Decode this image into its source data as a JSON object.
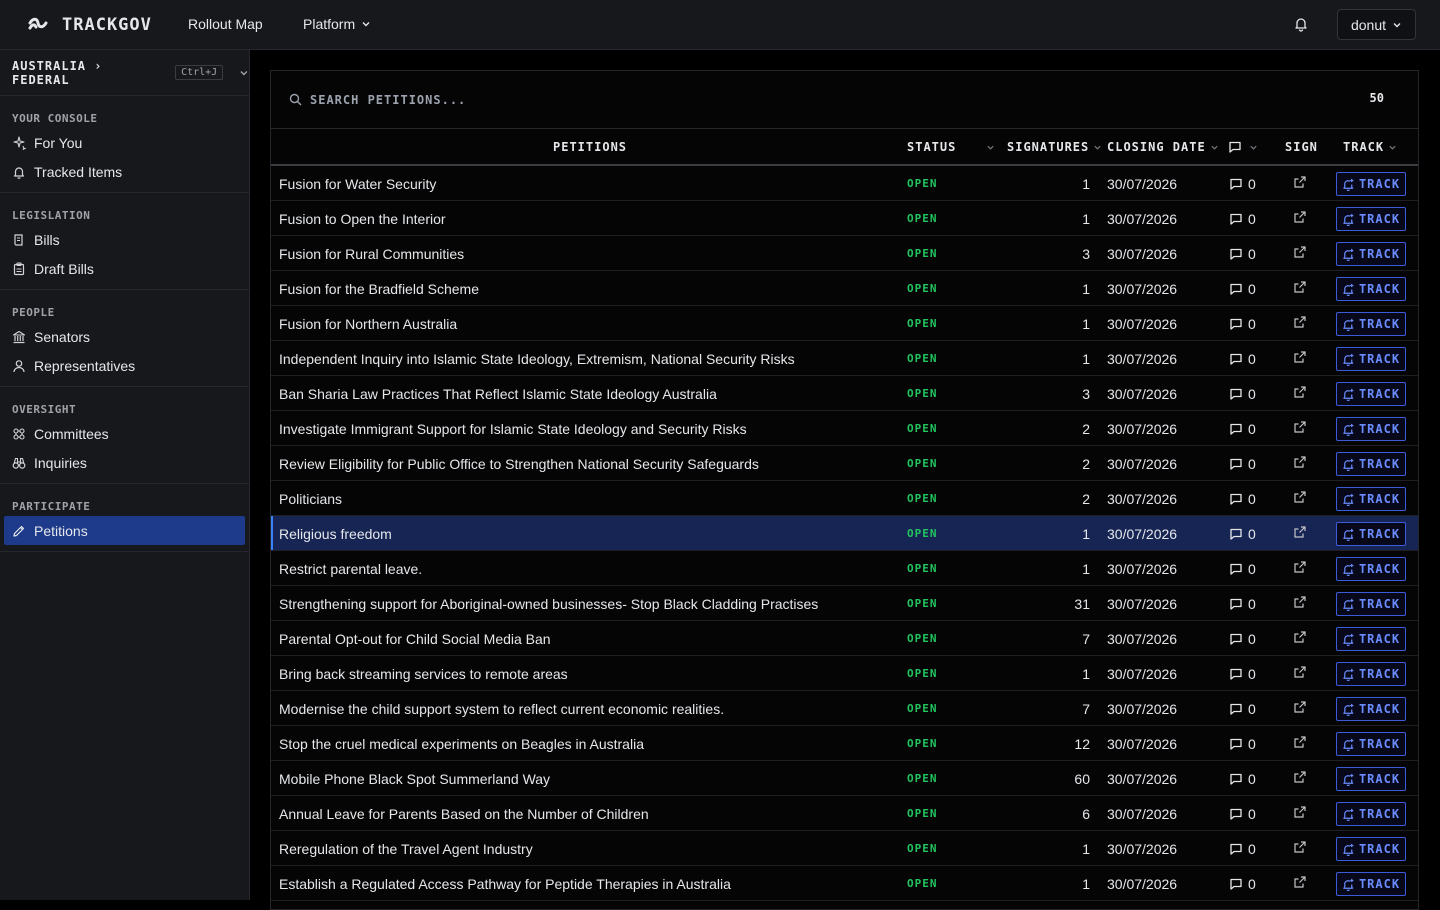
{
  "app": {
    "name": "TRACKGOV"
  },
  "nav": {
    "rollout": "Rollout Map",
    "platform": "Platform",
    "user": "donut"
  },
  "sidebar": {
    "jurisdiction": "AUSTRALIA › FEDERAL",
    "shortcut": "Ctrl+J",
    "groups": [
      {
        "title": "YOUR CONSOLE",
        "items": [
          {
            "label": "For You",
            "icon": "sparkles-icon"
          },
          {
            "label": "Tracked Items",
            "icon": "bell-icon"
          }
        ]
      },
      {
        "title": "LEGISLATION",
        "items": [
          {
            "label": "Bills",
            "icon": "scroll-icon"
          },
          {
            "label": "Draft Bills",
            "icon": "clipboard-icon"
          }
        ]
      },
      {
        "title": "PEOPLE",
        "items": [
          {
            "label": "Senators",
            "icon": "landmark-icon"
          },
          {
            "label": "Representatives",
            "icon": "user-icon"
          }
        ]
      },
      {
        "title": "OVERSIGHT",
        "items": [
          {
            "label": "Committees",
            "icon": "network-icon"
          },
          {
            "label": "Inquiries",
            "icon": "binoculars-icon"
          }
        ]
      },
      {
        "title": "PARTICIPATE",
        "items": [
          {
            "label": "Petitions",
            "icon": "pencil-icon",
            "active": true
          }
        ]
      }
    ]
  },
  "search": {
    "placeholder": "SEARCH PETITIONS...",
    "count": "50"
  },
  "table": {
    "headers": {
      "petitions": "PETITIONS",
      "status": "STATUS",
      "signatures": "SIGNATURES",
      "closing": "CLOSING DATE",
      "sign": "SIGN",
      "track": "TRACK"
    },
    "track_label": "TRACK",
    "rows": [
      {
        "title": "Fusion for Water Security",
        "status": "OPEN",
        "signatures": "1",
        "closing": "30/07/2026",
        "comments": "0"
      },
      {
        "title": "Fusion to Open the Interior",
        "status": "OPEN",
        "signatures": "1",
        "closing": "30/07/2026",
        "comments": "0"
      },
      {
        "title": "Fusion for Rural Communities",
        "status": "OPEN",
        "signatures": "3",
        "closing": "30/07/2026",
        "comments": "0"
      },
      {
        "title": "Fusion for the Bradfield Scheme",
        "status": "OPEN",
        "signatures": "1",
        "closing": "30/07/2026",
        "comments": "0"
      },
      {
        "title": "Fusion for Northern Australia",
        "status": "OPEN",
        "signatures": "1",
        "closing": "30/07/2026",
        "comments": "0"
      },
      {
        "title": "Independent Inquiry into Islamic State Ideology, Extremism, National Security Risks",
        "status": "OPEN",
        "signatures": "1",
        "closing": "30/07/2026",
        "comments": "0"
      },
      {
        "title": "Ban Sharia Law Practices That Reflect Islamic State Ideology Australia",
        "status": "OPEN",
        "signatures": "3",
        "closing": "30/07/2026",
        "comments": "0"
      },
      {
        "title": "Investigate Immigrant Support for Islamic State Ideology and Security Risks",
        "status": "OPEN",
        "signatures": "2",
        "closing": "30/07/2026",
        "comments": "0"
      },
      {
        "title": "Review Eligibility for Public Office to Strengthen National Security Safeguards",
        "status": "OPEN",
        "signatures": "2",
        "closing": "30/07/2026",
        "comments": "0"
      },
      {
        "title": "Politicians",
        "status": "OPEN",
        "signatures": "2",
        "closing": "30/07/2026",
        "comments": "0"
      },
      {
        "title": "Religious freedom",
        "status": "OPEN",
        "signatures": "1",
        "closing": "30/07/2026",
        "comments": "0",
        "selected": true
      },
      {
        "title": "Restrict parental leave.",
        "status": "OPEN",
        "signatures": "1",
        "closing": "30/07/2026",
        "comments": "0"
      },
      {
        "title": "Strengthening support for Aboriginal-owned businesses- Stop Black Cladding Practises",
        "status": "OPEN",
        "signatures": "31",
        "closing": "30/07/2026",
        "comments": "0"
      },
      {
        "title": "Parental Opt-out for Child Social Media Ban",
        "status": "OPEN",
        "signatures": "7",
        "closing": "30/07/2026",
        "comments": "0"
      },
      {
        "title": "Bring back streaming services to remote areas",
        "status": "OPEN",
        "signatures": "1",
        "closing": "30/07/2026",
        "comments": "0"
      },
      {
        "title": "Modernise the child support system to reflect current economic realities.",
        "status": "OPEN",
        "signatures": "7",
        "closing": "30/07/2026",
        "comments": "0"
      },
      {
        "title": "Stop the cruel medical experiments on Beagles in Australia",
        "status": "OPEN",
        "signatures": "12",
        "closing": "30/07/2026",
        "comments": "0"
      },
      {
        "title": "Mobile Phone Black Spot Summerland Way",
        "status": "OPEN",
        "signatures": "60",
        "closing": "30/07/2026",
        "comments": "0"
      },
      {
        "title": "Annual Leave for Parents Based on the Number of Children",
        "status": "OPEN",
        "signatures": "6",
        "closing": "30/07/2026",
        "comments": "0"
      },
      {
        "title": "Reregulation of the Travel Agent Industry",
        "status": "OPEN",
        "signatures": "1",
        "closing": "30/07/2026",
        "comments": "0"
      },
      {
        "title": "Establish a Regulated Access Pathway for Peptide Therapies in Australia",
        "status": "OPEN",
        "signatures": "1",
        "closing": "30/07/2026",
        "comments": "0"
      }
    ]
  },
  "colors": {
    "status_open": "#22c55e",
    "accent": "#3b5bdb",
    "selected_row": "#172554",
    "active_nav": "#1e3a8a"
  }
}
